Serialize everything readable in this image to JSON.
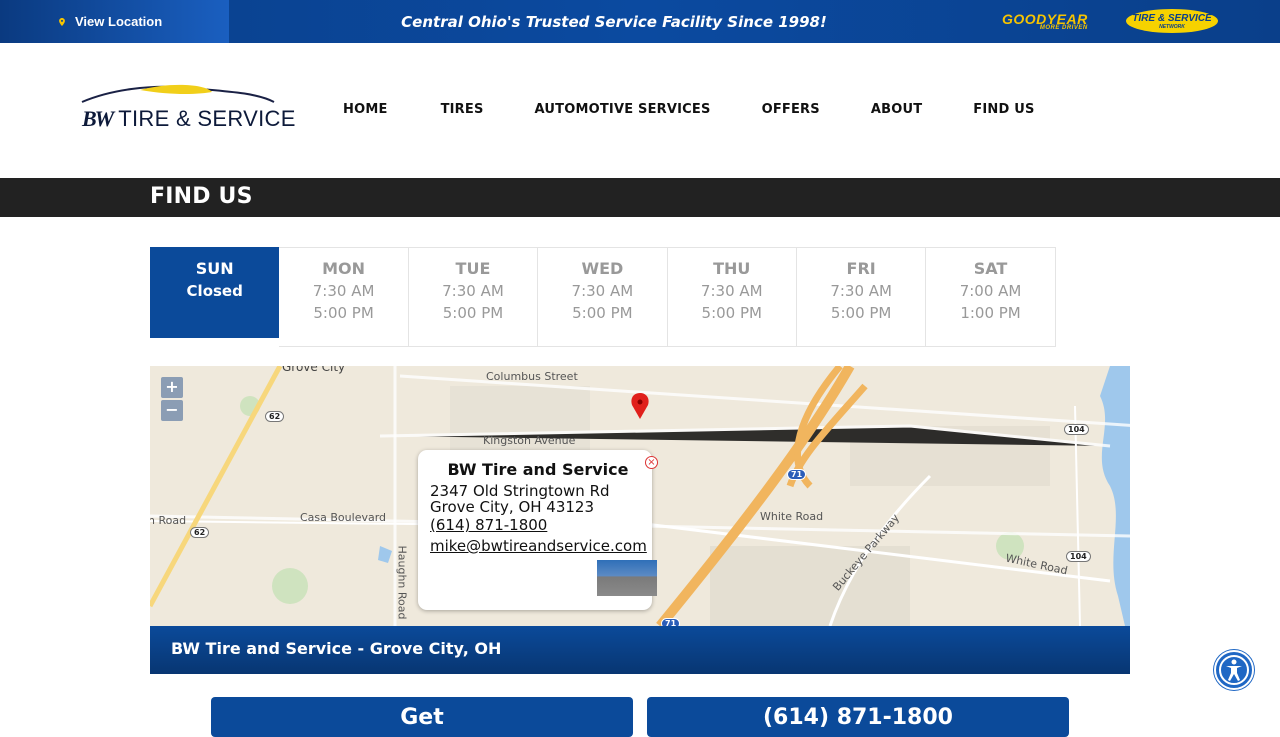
{
  "topbar": {
    "location_label": "View Location",
    "tagline": "Central Ohio's Trusted Service Facility Since 1998!",
    "goodyear_logo": "GOODYEAR",
    "goodyear_sub": "MORE DRIVEN",
    "network_logo": "TIRE & SERVICE",
    "network_sub": "NETWORK"
  },
  "header": {
    "logo_bw": "BW",
    "logo_rest": "TIRE & SERVICE",
    "nav": [
      "HOME",
      "TIRES",
      "AUTOMOTIVE SERVICES",
      "OFFERS",
      "ABOUT",
      "FIND US"
    ]
  },
  "page_title": "FIND US",
  "hours": [
    {
      "day": "SUN",
      "line1": "Closed",
      "line2": ""
    },
    {
      "day": "MON",
      "line1": "7:30 AM",
      "line2": "5:00 PM"
    },
    {
      "day": "TUE",
      "line1": "7:30 AM",
      "line2": "5:00 PM"
    },
    {
      "day": "WED",
      "line1": "7:30 AM",
      "line2": "5:00 PM"
    },
    {
      "day": "THU",
      "line1": "7:30 AM",
      "line2": "5:00 PM"
    },
    {
      "day": "FRI",
      "line1": "7:30 AM",
      "line2": "5:00 PM"
    },
    {
      "day": "SAT",
      "line1": "7:00 AM",
      "line2": "1:00 PM"
    }
  ],
  "map": {
    "zoom_in": "+",
    "zoom_out": "−",
    "labels": {
      "grove_city": "Grove City",
      "columbus_street": "Columbus Street",
      "kingston_avenue": "Kingston Avenue",
      "casa_boulevard": "Casa Boulevard",
      "white_road": "White Road",
      "white_road_2": "White Road",
      "buckeye_parkway": "Buckeye Parkway",
      "haughn_road": "Haughn Road",
      "n_road": "n Road"
    },
    "shields": {
      "r62a": "62",
      "r62b": "62",
      "r104a": "104",
      "r104b": "104",
      "i71a": "71",
      "i71b": "71"
    },
    "popup": {
      "title": "BW Tire and Service",
      "address1": "2347 Old Stringtown Rd",
      "address2": "Grove City, OH 43123",
      "phone": "(614) 871-1800",
      "email": "mike@bwtireandservice.com"
    },
    "caption": "BW Tire and Service - Grove City, OH"
  },
  "buttons": {
    "directions": "Get",
    "phone": "(614) 871-1800"
  },
  "colors": {
    "brand_blue": "#0b4a9a",
    "dark_bar": "#222222",
    "pin_red": "#e0201c"
  }
}
